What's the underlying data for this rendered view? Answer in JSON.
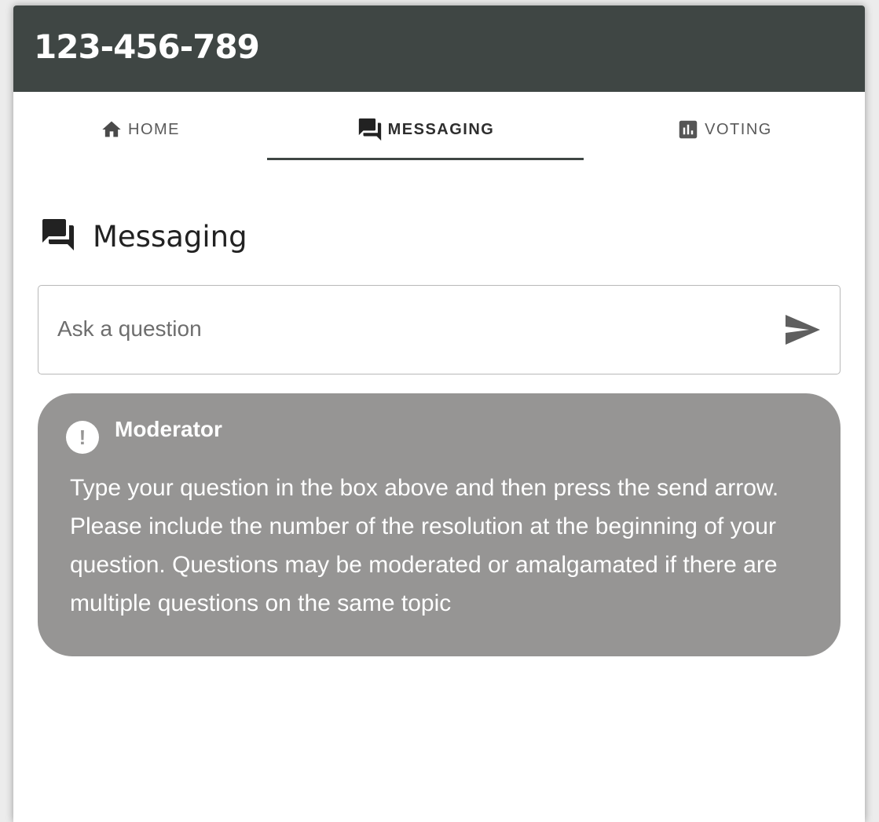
{
  "header": {
    "meeting_id": "123-456-789",
    "background": "#3f4644"
  },
  "tabs": [
    {
      "label": "HOME",
      "icon": "home-icon",
      "active": false
    },
    {
      "label": "MESSAGING",
      "icon": "chat-icon",
      "active": true
    },
    {
      "label": "VOTING",
      "icon": "bar-chart-icon",
      "active": false
    }
  ],
  "main": {
    "heading": "Messaging",
    "heading_icon": "chat-icon",
    "input": {
      "placeholder": "Ask a question",
      "value": ""
    },
    "send_icon": "send-icon",
    "messages": [
      {
        "author": "Moderator",
        "icon": "alert-icon",
        "badge_glyph": "!",
        "text": "Type your question in the box above and then press the send arrow. Please include the number of the resolution at the beginning of your question. Questions may be moderated or amalgamated if there are multiple questions on the same topic",
        "background": "#969594"
      }
    ]
  }
}
